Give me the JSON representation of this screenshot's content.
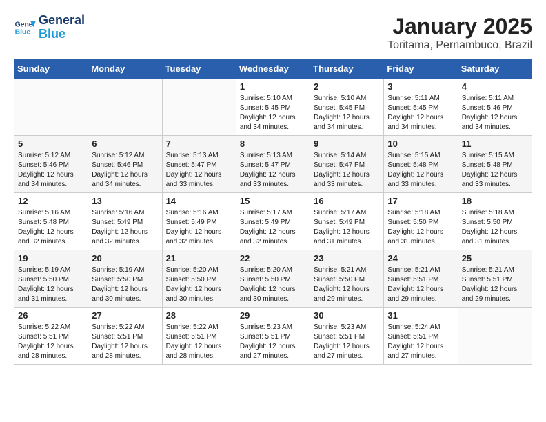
{
  "logo": {
    "line1": "General",
    "line2": "Blue"
  },
  "title": "January 2025",
  "subtitle": "Toritama, Pernambuco, Brazil",
  "days_of_week": [
    "Sunday",
    "Monday",
    "Tuesday",
    "Wednesday",
    "Thursday",
    "Friday",
    "Saturday"
  ],
  "weeks": [
    [
      {
        "num": "",
        "info": ""
      },
      {
        "num": "",
        "info": ""
      },
      {
        "num": "",
        "info": ""
      },
      {
        "num": "1",
        "info": "Sunrise: 5:10 AM\nSunset: 5:45 PM\nDaylight: 12 hours\nand 34 minutes."
      },
      {
        "num": "2",
        "info": "Sunrise: 5:10 AM\nSunset: 5:45 PM\nDaylight: 12 hours\nand 34 minutes."
      },
      {
        "num": "3",
        "info": "Sunrise: 5:11 AM\nSunset: 5:45 PM\nDaylight: 12 hours\nand 34 minutes."
      },
      {
        "num": "4",
        "info": "Sunrise: 5:11 AM\nSunset: 5:46 PM\nDaylight: 12 hours\nand 34 minutes."
      }
    ],
    [
      {
        "num": "5",
        "info": "Sunrise: 5:12 AM\nSunset: 5:46 PM\nDaylight: 12 hours\nand 34 minutes."
      },
      {
        "num": "6",
        "info": "Sunrise: 5:12 AM\nSunset: 5:46 PM\nDaylight: 12 hours\nand 34 minutes."
      },
      {
        "num": "7",
        "info": "Sunrise: 5:13 AM\nSunset: 5:47 PM\nDaylight: 12 hours\nand 33 minutes."
      },
      {
        "num": "8",
        "info": "Sunrise: 5:13 AM\nSunset: 5:47 PM\nDaylight: 12 hours\nand 33 minutes."
      },
      {
        "num": "9",
        "info": "Sunrise: 5:14 AM\nSunset: 5:47 PM\nDaylight: 12 hours\nand 33 minutes."
      },
      {
        "num": "10",
        "info": "Sunrise: 5:15 AM\nSunset: 5:48 PM\nDaylight: 12 hours\nand 33 minutes."
      },
      {
        "num": "11",
        "info": "Sunrise: 5:15 AM\nSunset: 5:48 PM\nDaylight: 12 hours\nand 33 minutes."
      }
    ],
    [
      {
        "num": "12",
        "info": "Sunrise: 5:16 AM\nSunset: 5:48 PM\nDaylight: 12 hours\nand 32 minutes."
      },
      {
        "num": "13",
        "info": "Sunrise: 5:16 AM\nSunset: 5:49 PM\nDaylight: 12 hours\nand 32 minutes."
      },
      {
        "num": "14",
        "info": "Sunrise: 5:16 AM\nSunset: 5:49 PM\nDaylight: 12 hours\nand 32 minutes."
      },
      {
        "num": "15",
        "info": "Sunrise: 5:17 AM\nSunset: 5:49 PM\nDaylight: 12 hours\nand 32 minutes."
      },
      {
        "num": "16",
        "info": "Sunrise: 5:17 AM\nSunset: 5:49 PM\nDaylight: 12 hours\nand 31 minutes."
      },
      {
        "num": "17",
        "info": "Sunrise: 5:18 AM\nSunset: 5:50 PM\nDaylight: 12 hours\nand 31 minutes."
      },
      {
        "num": "18",
        "info": "Sunrise: 5:18 AM\nSunset: 5:50 PM\nDaylight: 12 hours\nand 31 minutes."
      }
    ],
    [
      {
        "num": "19",
        "info": "Sunrise: 5:19 AM\nSunset: 5:50 PM\nDaylight: 12 hours\nand 31 minutes."
      },
      {
        "num": "20",
        "info": "Sunrise: 5:19 AM\nSunset: 5:50 PM\nDaylight: 12 hours\nand 30 minutes."
      },
      {
        "num": "21",
        "info": "Sunrise: 5:20 AM\nSunset: 5:50 PM\nDaylight: 12 hours\nand 30 minutes."
      },
      {
        "num": "22",
        "info": "Sunrise: 5:20 AM\nSunset: 5:50 PM\nDaylight: 12 hours\nand 30 minutes."
      },
      {
        "num": "23",
        "info": "Sunrise: 5:21 AM\nSunset: 5:50 PM\nDaylight: 12 hours\nand 29 minutes."
      },
      {
        "num": "24",
        "info": "Sunrise: 5:21 AM\nSunset: 5:51 PM\nDaylight: 12 hours\nand 29 minutes."
      },
      {
        "num": "25",
        "info": "Sunrise: 5:21 AM\nSunset: 5:51 PM\nDaylight: 12 hours\nand 29 minutes."
      }
    ],
    [
      {
        "num": "26",
        "info": "Sunrise: 5:22 AM\nSunset: 5:51 PM\nDaylight: 12 hours\nand 28 minutes."
      },
      {
        "num": "27",
        "info": "Sunrise: 5:22 AM\nSunset: 5:51 PM\nDaylight: 12 hours\nand 28 minutes."
      },
      {
        "num": "28",
        "info": "Sunrise: 5:22 AM\nSunset: 5:51 PM\nDaylight: 12 hours\nand 28 minutes."
      },
      {
        "num": "29",
        "info": "Sunrise: 5:23 AM\nSunset: 5:51 PM\nDaylight: 12 hours\nand 27 minutes."
      },
      {
        "num": "30",
        "info": "Sunrise: 5:23 AM\nSunset: 5:51 PM\nDaylight: 12 hours\nand 27 minutes."
      },
      {
        "num": "31",
        "info": "Sunrise: 5:24 AM\nSunset: 5:51 PM\nDaylight: 12 hours\nand 27 minutes."
      },
      {
        "num": "",
        "info": ""
      }
    ]
  ]
}
